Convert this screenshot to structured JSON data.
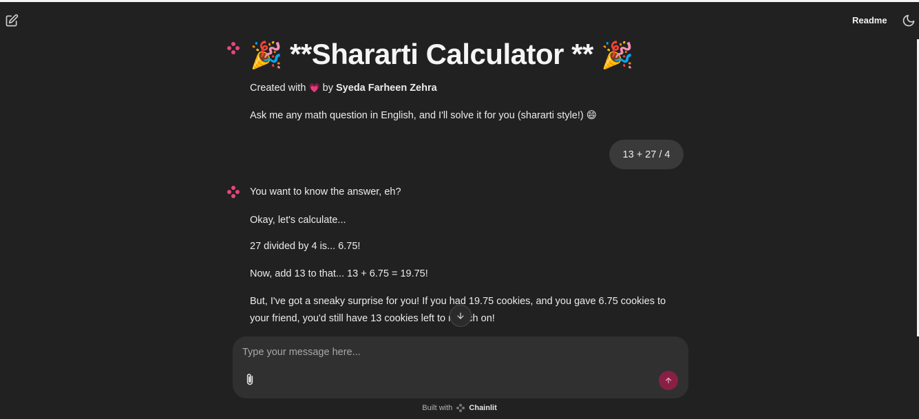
{
  "header": {
    "readme_label": "Readme",
    "new_chat_icon": "edit-icon",
    "theme_icon": "moon-icon"
  },
  "welcome": {
    "title_emoji_left": "🎉",
    "title_text": "**Shararti Calculator **",
    "title_emoji_right": "🎉",
    "created_prefix": "Created with",
    "created_heart": "💗",
    "created_by": "by",
    "author": "Syeda Farheen Zehra",
    "intro": "Ask me any math question in English, and I'll solve it for you (shararti style!) 😄"
  },
  "user_message": {
    "text": "13 + 27 / 4"
  },
  "assistant_message": {
    "lines": [
      "You want to know the answer, eh?",
      "Okay, let's calculate...",
      "27 divided by 4 is... 6.75!",
      "Now, add 13 to that... 13 + 6.75 = 19.75!",
      "But, I've got a sneaky surprise for you! If you had 19.75 cookies, and you gave 6.75 cookies to your friend, you'd still have 13 cookies left to munch on!"
    ]
  },
  "composer": {
    "placeholder": "Type your message here...",
    "attach_icon": "paperclip-icon",
    "send_icon": "arrow-up-icon"
  },
  "footer": {
    "built_with": "Built with",
    "brand": "Chainlit"
  },
  "colors": {
    "background": "#212121",
    "accent": "#e8457c",
    "send_button": "#8a1f45",
    "bubble": "#3a3a3a"
  }
}
